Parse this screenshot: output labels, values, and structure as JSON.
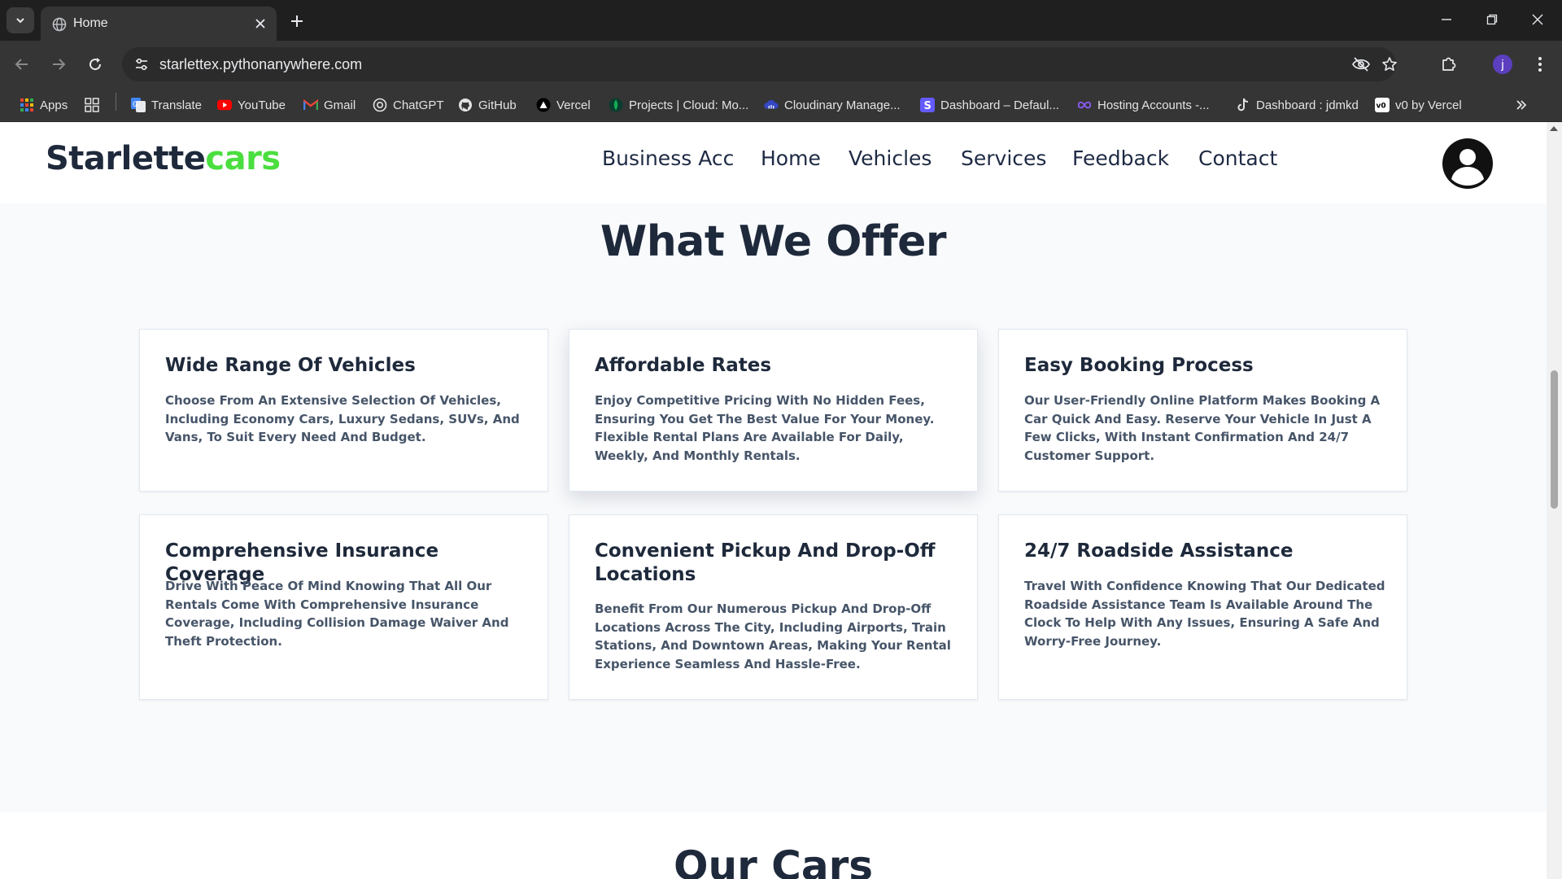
{
  "browser": {
    "tab_title": "Home",
    "url": "starlettex.pythonanywhere.com",
    "profile_initial": "j",
    "bookmarks": [
      {
        "label": "Apps",
        "icon": "apps-grid-icon"
      },
      {
        "label": "Translate",
        "icon": "translate-icon"
      },
      {
        "label": "YouTube",
        "icon": "youtube-icon"
      },
      {
        "label": "Gmail",
        "icon": "gmail-icon"
      },
      {
        "label": "ChatGPT",
        "icon": "chatgpt-icon"
      },
      {
        "label": "GitHub",
        "icon": "github-icon"
      },
      {
        "label": "Vercel",
        "icon": "vercel-icon"
      },
      {
        "label": "Projects | Cloud: Mo...",
        "icon": "mongodb-icon"
      },
      {
        "label": "Cloudinary Manage...",
        "icon": "cloudinary-icon"
      },
      {
        "label": "Dashboard – Defaul...",
        "icon": "stripe-icon"
      },
      {
        "label": "Hosting Accounts -...",
        "icon": "hosting-icon"
      },
      {
        "label": "Dashboard : jdmkd",
        "icon": "tiktok-icon"
      },
      {
        "label": "v0 by Vercel",
        "icon": "v0-icon"
      }
    ]
  },
  "site": {
    "logo": {
      "primary": "Starlette",
      "accent": "cars"
    },
    "nav": [
      "Business Acc",
      "Home",
      "Vehicles",
      "Services",
      "Feedback",
      "Contact"
    ],
    "offer_heading": "What We Offer",
    "cards": [
      {
        "title": "Wide Range Of Vehicles",
        "description": "Choose From An Extensive Selection Of Vehicles, Including Economy Cars, Luxury Sedans, SUVs, And Vans, To Suit Every Need And Budget."
      },
      {
        "title": "Affordable Rates",
        "description": "Enjoy Competitive Pricing With No Hidden Fees, Ensuring You Get The Best Value For Your Money. Flexible Rental Plans Are Available For Daily, Weekly, And Monthly Rentals."
      },
      {
        "title": "Easy Booking Process",
        "description": "Our User-Friendly Online Platform Makes Booking A Car Quick And Easy. Reserve Your Vehicle In Just A Few Clicks, With Instant Confirmation And 24/7 Customer Support."
      },
      {
        "title": "Comprehensive Insurance Coverage",
        "description": "Drive With Peace Of Mind Knowing That All Our Rentals Come With Comprehensive Insurance Coverage, Including Collision Damage Waiver And Theft Protection."
      },
      {
        "title": "Convenient Pickup And Drop-Off Locations",
        "description": "Benefit From Our Numerous Pickup And Drop-Off Locations Across The City, Including Airports, Train Stations, And Downtown Areas, Making Your Rental Experience Seamless And Hassle-Free."
      },
      {
        "title": "24/7 Roadside Assistance",
        "description": "Travel With Confidence Knowing That Our Dedicated Roadside Assistance Team Is Available Around The Clock To Help With Any Issues, Ensuring A Safe And Worry-Free Journey."
      }
    ],
    "cars_heading": "Our Cars"
  },
  "colors": {
    "brand_dark": "#1e293b",
    "brand_accent": "#4ade3f",
    "page_bg": "#f8fafc",
    "browser_frame": "#1f1f1f"
  }
}
